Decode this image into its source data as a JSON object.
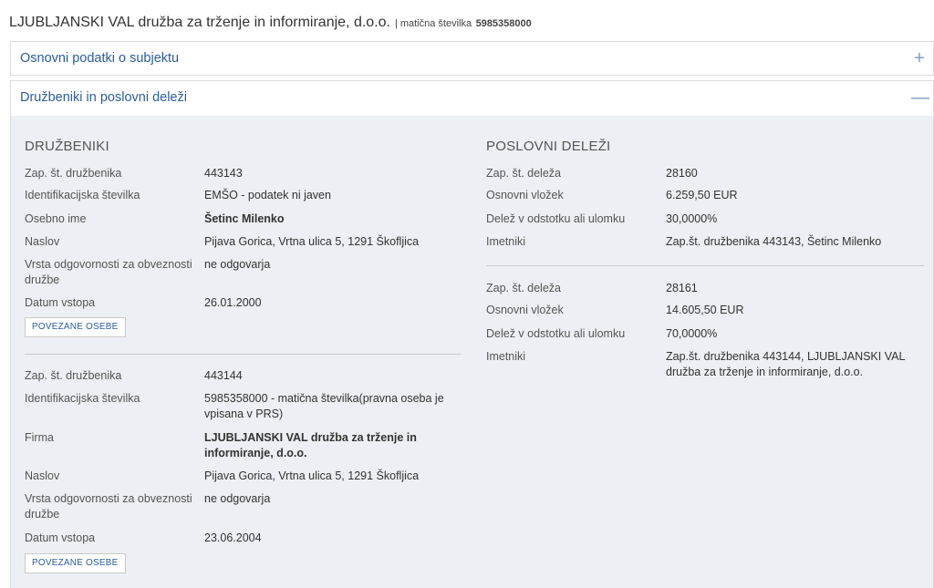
{
  "header": {
    "company_name": "LJUBLJANSKI VAL družba za trženje in informiranje, d.o.o.",
    "separator": "|",
    "reg_label": "matična številka",
    "reg_number": "5985358000"
  },
  "panels": [
    {
      "title": "Osnovni podatki o subjektu",
      "toggle": "+"
    },
    {
      "title": "Družbeniki in poslovni deleži",
      "toggle": "—"
    }
  ],
  "druzbeniki": {
    "title": "DRUŽBENIKI",
    "labels": {
      "zap": "Zap. št. družbenika",
      "id": "Identifikacijska številka",
      "ime": "Osebno ime",
      "firma": "Firma",
      "naslov": "Naslov",
      "vrsta_line1": "Vrsta odgovornosti za obveznosti",
      "vrsta_line2": "družbe",
      "datum": "Datum vstopa"
    },
    "button_label": "POVEZANE OSEBE",
    "items": [
      {
        "zap": "443143",
        "id": "EMŠO - podatek ni javen",
        "name": "Šetinc  Milenko",
        "naslov": "Pijava Gorica, Vrtna ulica 5, 1291 Škofljica",
        "vrsta": "ne odgovarja",
        "datum": "26.01.2000"
      },
      {
        "zap": "443144",
        "id_line1": "5985358000 - matična številka(pravna oseba je",
        "id_line2": "vpisana v PRS)",
        "firma_line1": "LJUBLJANSKI VAL družba za trženje in",
        "firma_line2": "informiranje, d.o.o.",
        "naslov": "Pijava Gorica, Vrtna ulica 5, 1291 Škofljica",
        "vrsta": "ne odgovarja",
        "datum": "23.06.2004"
      }
    ]
  },
  "delezi": {
    "title": "POSLOVNI DELEŽI",
    "labels": {
      "zap": "Zap. št. deleža",
      "vlozek": "Osnovni vložek",
      "delez": "Delež v odstotku ali ulomku",
      "imetniki": "Imetniki"
    },
    "items": [
      {
        "zap": "28160",
        "vlozek": "6.259,50 EUR",
        "delez": "30,0000%",
        "imetniki": "Zap.št. družbenika 443143, Šetinc  Milenko"
      },
      {
        "zap": "28161",
        "vlozek": "14.605,50 EUR",
        "delez": "70,0000%",
        "imetniki_line1": "Zap.št. družbenika 443144, LJUBLJANSKI VAL",
        "imetniki_line2": "družba za trženje in informiranje, d.o.o."
      }
    ]
  },
  "colors": {
    "link_blue": "#2a5d9f",
    "panel_body_bg": "#eceff3",
    "toggle_blue": "#7f9ec6"
  }
}
